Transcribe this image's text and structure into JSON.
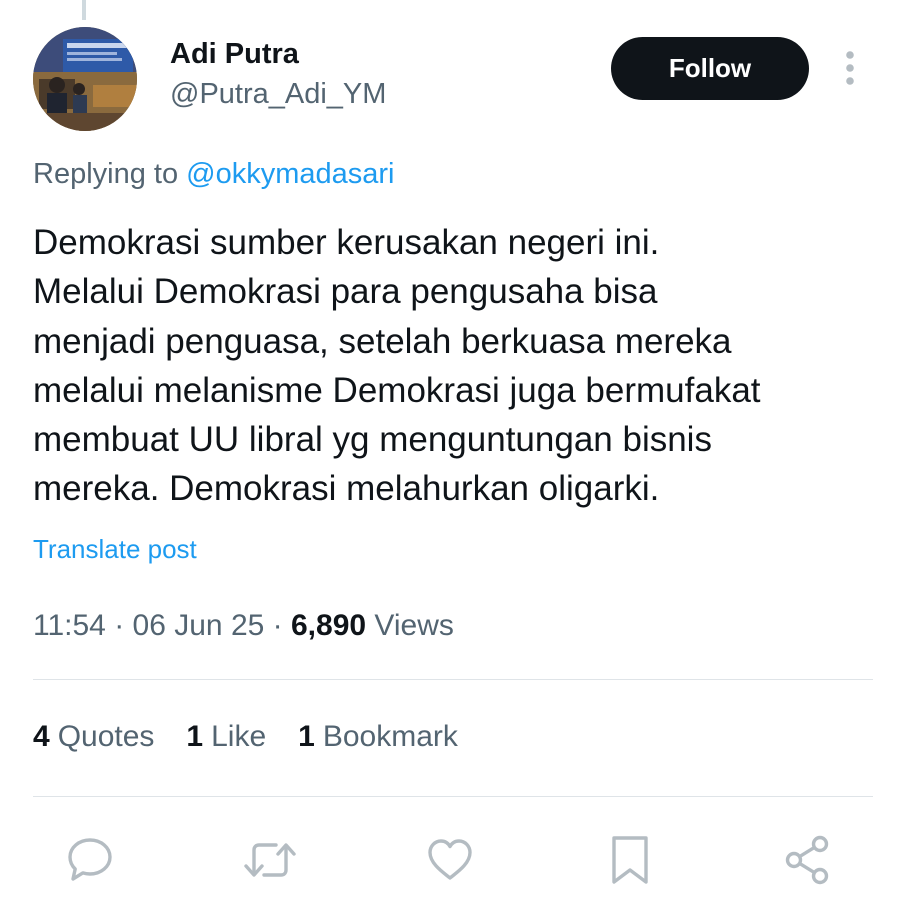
{
  "author": {
    "display_name": "Adi Putra",
    "handle": "@Putra_Adi_YM"
  },
  "header": {
    "follow_label": "Follow",
    "more_icon": "more-vertical-icon"
  },
  "reply": {
    "prefix": "Replying to ",
    "mention": "@okkymadasari"
  },
  "tweet": {
    "lines": [
      "Demokrasi sumber kerusakan negeri ini.",
      "Melalui Demokrasi para pengusaha bisa",
      "menjadi penguasa, setelah berkuasa mereka",
      "melalui melanisme Demokrasi juga bermufakat",
      "membuat UU libral yg menguntungan bisnis",
      "mereka. Demokrasi melahurkan oligarki."
    ],
    "translate_label": "Translate post"
  },
  "meta": {
    "time": "11:54",
    "separator": " · ",
    "date": "06 Jun 25",
    "views_count": "6,890",
    "views_label": " Views"
  },
  "stats": {
    "quotes_count": "4",
    "quotes_label": "Quotes",
    "likes_count": "1",
    "likes_label": "Like",
    "bookmarks_count": "1",
    "bookmarks_label": "Bookmark"
  },
  "actions": [
    "reply-icon",
    "retweet-icon",
    "like-icon",
    "bookmark-icon",
    "share-icon"
  ],
  "colors": {
    "text_primary": "#0f1419",
    "text_secondary": "#536471",
    "accent": "#1d9bf0",
    "divider": "#dfe4e8"
  }
}
